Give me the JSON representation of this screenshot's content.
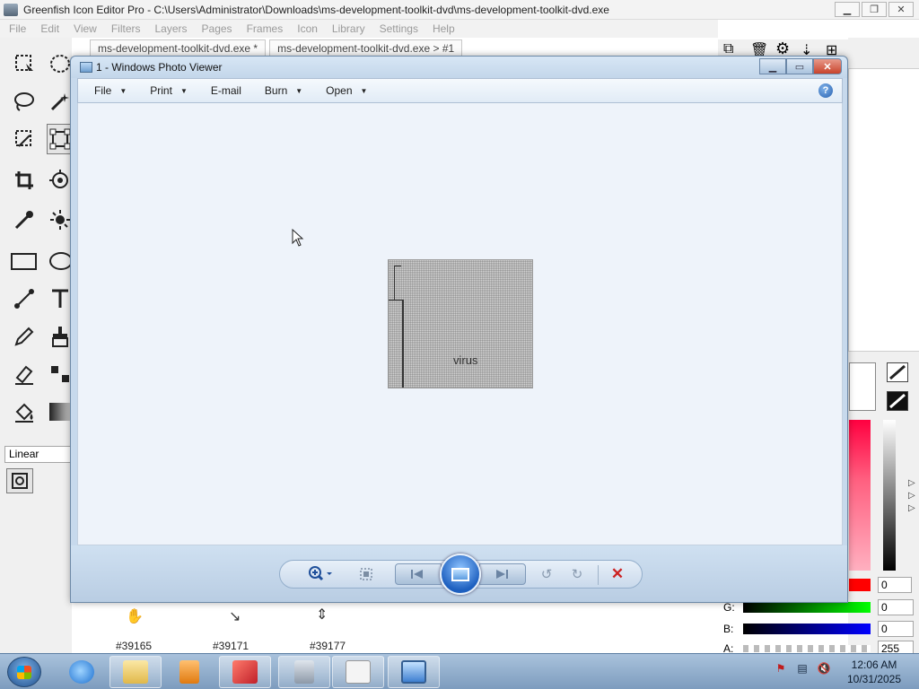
{
  "greenfish": {
    "title": "Greenfish Icon Editor Pro - C:\\Users\\Administrator\\Downloads\\ms-development-toolkit-dvd\\ms-development-toolkit-dvd.exe",
    "menu": [
      "File",
      "Edit",
      "View",
      "Filters",
      "Layers",
      "Pages",
      "Frames",
      "Icon",
      "Library",
      "Settings",
      "Help"
    ],
    "tabs": [
      "ms-development-toolkit-dvd.exe *",
      "ms-development-toolkit-dvd.exe > #1"
    ],
    "gradient_select": "Linear",
    "glyphs": [
      {
        "symbol": "✋",
        "label": "#39165"
      },
      {
        "symbol": "↘",
        "label": "#39171"
      },
      {
        "symbol": "⇕",
        "label": "#39177"
      }
    ],
    "channels": [
      {
        "label": "G:",
        "value": "0",
        "color": "#22aa22"
      },
      {
        "label": "B:",
        "value": "0",
        "color": "#0000dd"
      },
      {
        "label": "A:",
        "value": "255",
        "color": "#888888"
      }
    ],
    "red_value": "0"
  },
  "photo_viewer": {
    "title": "1 - Windows Photo Viewer",
    "toolbar": [
      "File",
      "Print",
      "E-mail",
      "Burn",
      "Open"
    ],
    "image_caption": "virus"
  },
  "taskbar": {
    "time": "12:06 AM",
    "date": "10/31/2025"
  }
}
